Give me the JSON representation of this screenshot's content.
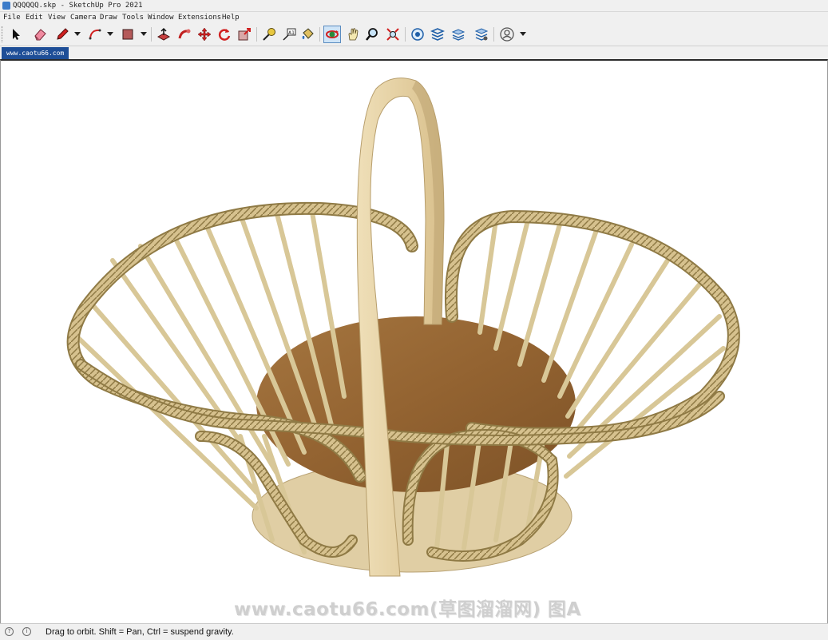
{
  "window": {
    "title": "QQQQQQ.skp - SketchUp Pro 2021"
  },
  "menu": [
    "File",
    "Edit",
    "View",
    "Camera",
    "Draw",
    "Tools",
    "Window",
    "Extensions",
    "Help"
  ],
  "toolbar": {
    "tools": [
      "select-icon",
      "eraser-icon",
      "pencil-icon",
      "arc-icon",
      "rectangle-icon",
      "push-pull-icon",
      "follow-me-icon",
      "move-icon",
      "rotate-icon",
      "scale-icon",
      "tape-measure-icon",
      "text-icon",
      "paint-bucket-icon",
      "orbit-icon",
      "pan-icon",
      "zoom-icon",
      "zoom-extents-icon",
      "warehouse-icon",
      "extension-warehouse-icon",
      "layout-icon",
      "extension-manager-icon",
      "account-icon"
    ],
    "active_tool": "orbit-icon"
  },
  "scene_tab": {
    "label": "www.caotu66.com"
  },
  "watermark": {
    "text": "www.caotu66.com(草图溜溜网) 图A"
  },
  "status": {
    "text": "Drag to orbit. Shift = Pan, Ctrl = suspend gravity."
  },
  "colors": {
    "viewport_bg": "#ffffff",
    "wicker": "#d8c493",
    "wicker_dark": "#8f7a45",
    "wood_floor": "#9c6b35",
    "handle": "#e7d3a8",
    "tab_bg": "#1e4e97"
  }
}
